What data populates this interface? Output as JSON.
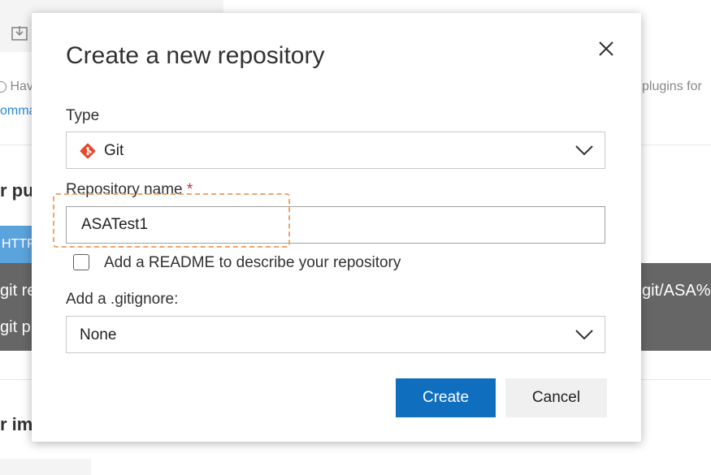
{
  "background": {
    "have_text": "Hav",
    "plugins_text": "plugins for",
    "link_text": "omma",
    "heading_1": "r pu",
    "https_tab": "HTTP",
    "code_line_1_left": "git re",
    "code_line_1_right": "git/ASA%",
    "code_line_2_left": "git pu",
    "heading_2": "r im"
  },
  "dialog": {
    "title": "Create a new repository",
    "close_icon": "close-icon",
    "type": {
      "label": "Type",
      "selected": "Git",
      "icon": "git-icon"
    },
    "repository_name": {
      "label": "Repository name",
      "required_marker": "*",
      "value": "ASATest1"
    },
    "readme": {
      "label": "Add a README to describe your repository",
      "checked": false
    },
    "gitignore": {
      "label": "Add a .gitignore:",
      "selected": "None"
    },
    "buttons": {
      "create": "Create",
      "cancel": "Cancel"
    }
  },
  "colors": {
    "primary": "#106ebe",
    "git_icon": "#e8482b",
    "highlight": "#f0a46a",
    "required": "#c4314b"
  }
}
